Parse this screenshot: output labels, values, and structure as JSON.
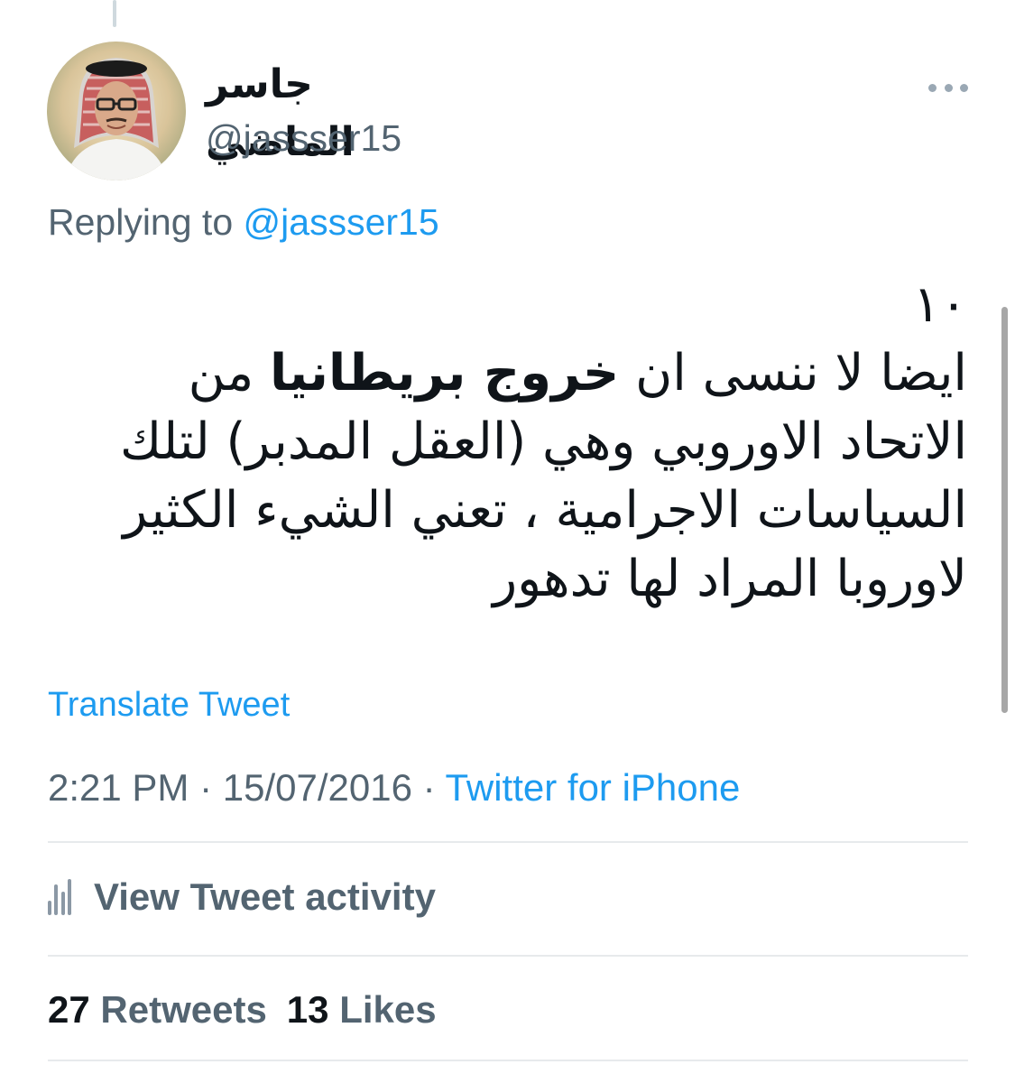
{
  "author": {
    "display_name": "جاسر الماضي",
    "handle": "@jassser15",
    "avatar": "profile-photo"
  },
  "replying_to": {
    "prefix": "Replying to",
    "handle": "@jassser15"
  },
  "tweet": {
    "number": "١٠",
    "line1_start": "ايضا لا ننسى ان ",
    "line1_bold": "خروج بريطانيا",
    "line1_end": " من",
    "line2": "الاتحاد الاوروبي وهي (العقل المدبر) لتلك",
    "line3": "السياسات الاجرامية ، تعني الشيء الكثير",
    "line4": "لاوروبا المراد لها تدهور"
  },
  "translate_label": "Translate Tweet",
  "meta": {
    "time": "2:21 PM",
    "date": "15/07/2016",
    "separator": " · ",
    "source": "Twitter for iPhone"
  },
  "activity": {
    "label": "View Tweet activity",
    "icon": "bar-chart-icon"
  },
  "stats": {
    "retweets_count": "27",
    "retweets_label": "Retweets",
    "likes_count": "13",
    "likes_label": "Likes"
  },
  "colors": {
    "accent": "#1d9bf0",
    "secondary_text": "#536471",
    "primary_text": "#0f1419",
    "divider": "#e7eaec"
  }
}
